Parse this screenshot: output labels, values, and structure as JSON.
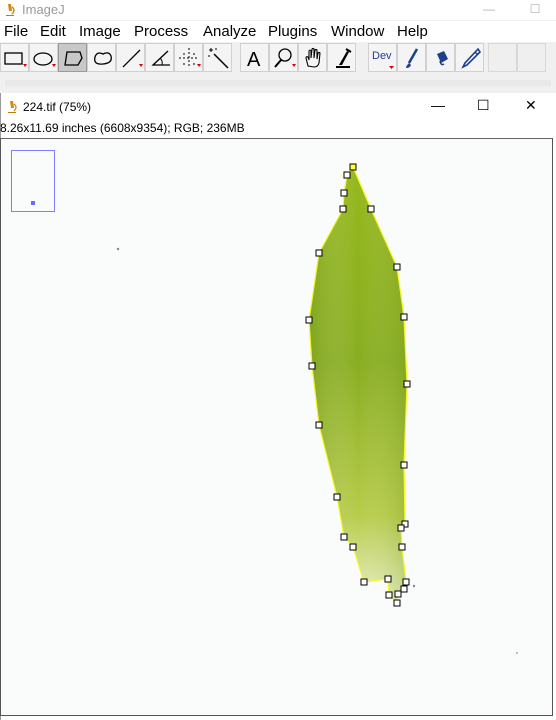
{
  "app": {
    "title": "ImageJ"
  },
  "menu": [
    "File",
    "Edit",
    "Image",
    "Process",
    "Analyze",
    "Plugins",
    "Window",
    "Help"
  ],
  "toolbar": {
    "tools": [
      {
        "name": "rectangle-tool-icon"
      },
      {
        "name": "oval-tool-icon"
      },
      {
        "name": "polygon-tool-icon",
        "active": true
      },
      {
        "name": "freehand-tool-icon"
      },
      {
        "name": "line-tool-icon"
      },
      {
        "name": "angle-tool-icon"
      },
      {
        "name": "point-tool-icon"
      },
      {
        "name": "wand-tool-icon"
      },
      {
        "name": "text-tool-icon"
      },
      {
        "name": "magnifier-tool-icon"
      },
      {
        "name": "hand-tool-icon"
      },
      {
        "name": "color-picker-tool-icon"
      }
    ],
    "dev_label": "Dev",
    "extra_tools": [
      "brush-tool-icon",
      "flood-fill-tool-icon",
      "pencil-tool-icon"
    ],
    "text_tool_glyph": "A"
  },
  "image_window": {
    "title": "224.tif (75%)",
    "info": "8.26x11.69 inches (6608x9354); RGB; 236MB",
    "buttons": {
      "minimize": "—",
      "maximize": "☐",
      "close": "✕"
    }
  },
  "colors": {
    "selection_outline": "#ffff30",
    "handle_fill": "#ffffff",
    "handle_active": "#ffff30",
    "leaf_green": "#8fb21e",
    "navigator_border": "#8080ff"
  }
}
